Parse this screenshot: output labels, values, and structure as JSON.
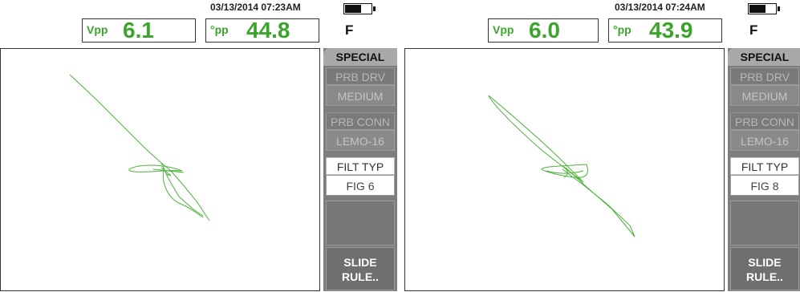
{
  "panels": [
    {
      "datetime": "03/13/2014   07:23AM",
      "battery_level": 0.65,
      "readout_vpp": {
        "label": "Vpp",
        "value": "6.1"
      },
      "readout_deg": {
        "label": "°pp",
        "value": "44.8"
      },
      "mode": "F",
      "menu": {
        "title": "SPECIAL",
        "prb_drv": {
          "label": "PRB DRV",
          "value": "MEDIUM"
        },
        "prb_conn": {
          "label": "PRB CONN",
          "value": "LEMO-16"
        },
        "filt_typ": {
          "label": "FILT TYP",
          "value": "FIG 6"
        },
        "slide_rule_line1": "SLIDE",
        "slide_rule_line2": "RULE.."
      },
      "trace_color": "#4cb33a"
    },
    {
      "datetime": "03/13/2014   07:24AM",
      "battery_level": 0.65,
      "readout_vpp": {
        "label": "Vpp",
        "value": "6.0"
      },
      "readout_deg": {
        "label": "°pp",
        "value": "43.9"
      },
      "mode": "F",
      "menu": {
        "title": "SPECIAL",
        "prb_drv": {
          "label": "PRB DRV",
          "value": "MEDIUM"
        },
        "prb_conn": {
          "label": "PRB CONN",
          "value": "LEMO-16"
        },
        "filt_typ": {
          "label": "FILT TYP",
          "value": "FIG 8"
        },
        "slide_rule_line1": "SLIDE",
        "slide_rule_line2": "RULE.."
      },
      "trace_color": "#4cb33a"
    }
  ]
}
